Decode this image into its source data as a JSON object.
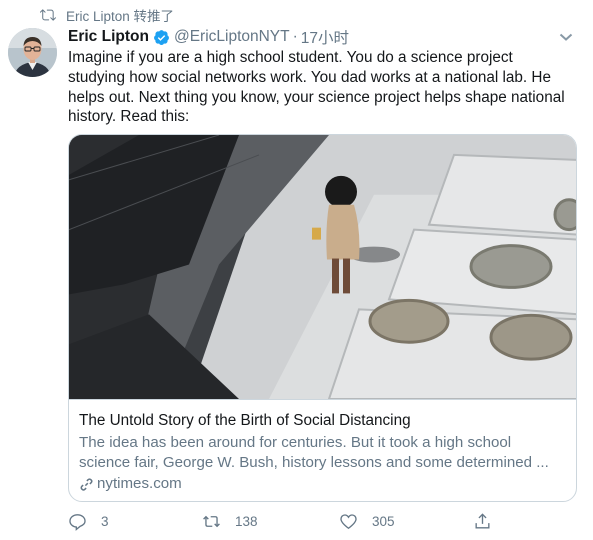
{
  "retweet": {
    "icon": "retweet-icon",
    "text": "Eric Lipton 转推了"
  },
  "author": {
    "name": "Eric Lipton",
    "handle": "@EricLiptonNYT",
    "separator": "·",
    "time": "17小时",
    "verified": true,
    "verified_color": "#1da1f2"
  },
  "tweet": {
    "text": "Imagine if you are a high school student. You do a science project\nstudying how social networks work. You dad works at a national lab. He\nhelps out. Next thing you know, your science project helps shape national\nhistory. Read this:"
  },
  "card": {
    "title": "The Untold Story of the Birth of Social Distancing",
    "description": "The idea has been around for centuries. But it took a high school\nscience fair, George W. Bush, history lessons and some determined ...",
    "domain": "nytimes.com",
    "domain_icon": "link-icon"
  },
  "actions": {
    "reply": {
      "icon": "reply-icon",
      "count": "3"
    },
    "retweet": {
      "icon": "retweet-icon",
      "count": "138"
    },
    "like": {
      "icon": "heart-icon",
      "count": "305"
    },
    "share": {
      "icon": "share-icon"
    }
  },
  "colors": {
    "text": "#14171a",
    "secondary": "#657786",
    "border": "#ccd6dd",
    "accent": "#1da1f2"
  }
}
